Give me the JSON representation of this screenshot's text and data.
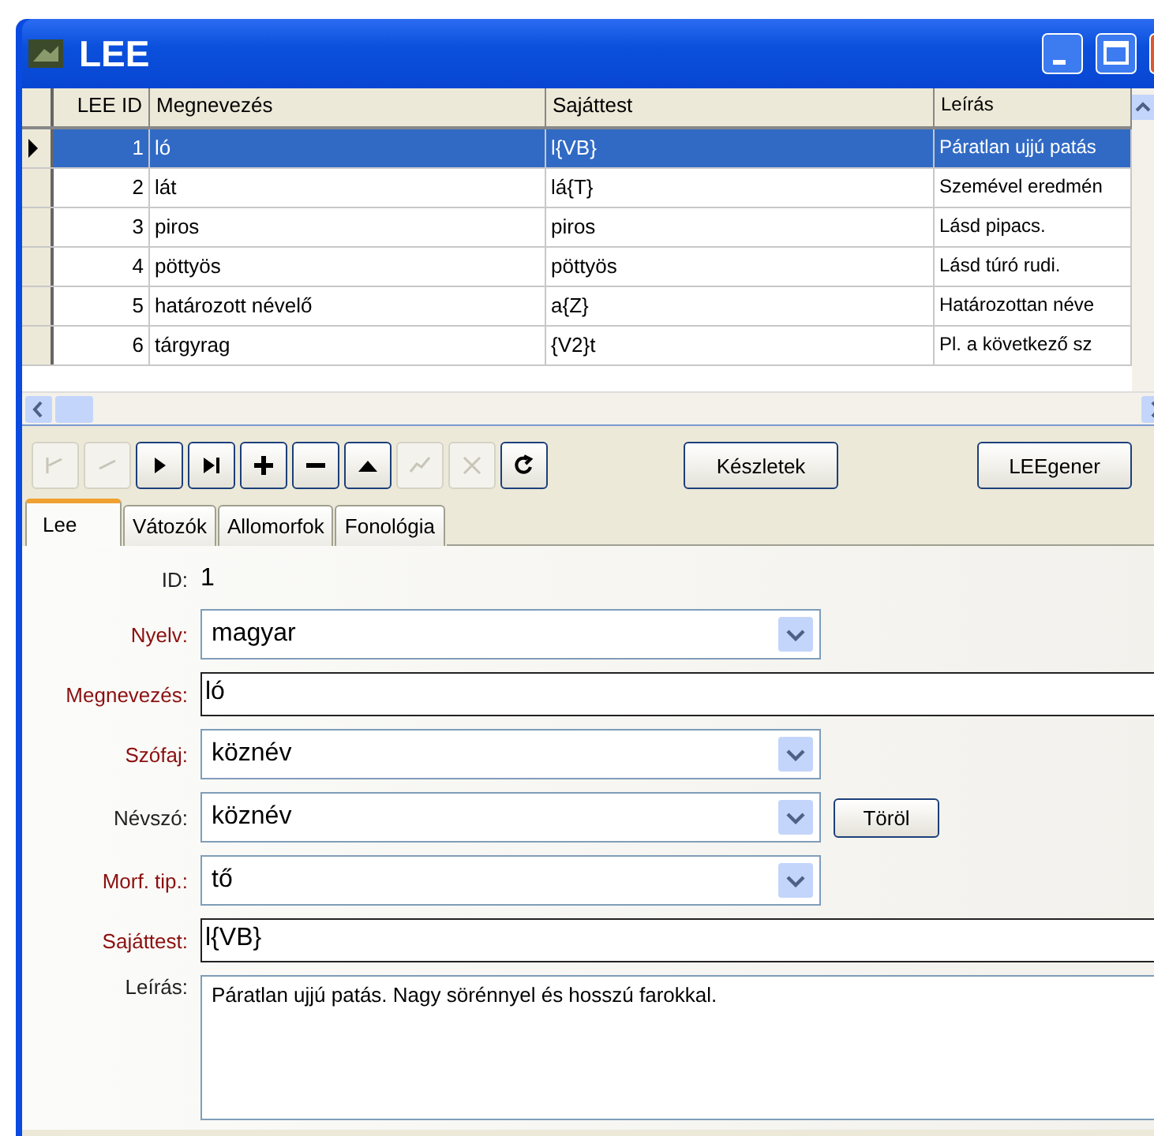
{
  "window": {
    "title": "LEE"
  },
  "table": {
    "columns": [
      "LEE ID",
      "Megnevezés",
      "Sajáttest",
      "Leírás"
    ],
    "rows": [
      {
        "cells": [
          "1",
          "ló",
          "l{VB}",
          "Páratlan ujjú patás"
        ],
        "selected": true
      },
      {
        "cells": [
          "2",
          "lát",
          "lá{T}",
          "Szemével eredmén"
        ],
        "selected": false
      },
      {
        "cells": [
          "3",
          "piros",
          "piros",
          "Lásd pipacs."
        ],
        "selected": false
      },
      {
        "cells": [
          "4",
          "pöttyös",
          "pöttyös",
          "Lásd túró rudi."
        ],
        "selected": false
      },
      {
        "cells": [
          "5",
          "határozott névelő",
          "a{Z}",
          "Határozottan néve"
        ],
        "selected": false
      },
      {
        "cells": [
          "6",
          "tárgyrag",
          "{V2}t",
          "Pl. a következő sz"
        ],
        "selected": false
      }
    ]
  },
  "toolbar": [
    {
      "kind": "first",
      "disabled": true
    },
    {
      "kind": "prev",
      "disabled": true
    },
    {
      "kind": "next",
      "disabled": false
    },
    {
      "kind": "last",
      "disabled": false
    },
    {
      "kind": "add",
      "disabled": false
    },
    {
      "kind": "remove",
      "disabled": false
    },
    {
      "kind": "up",
      "disabled": false
    },
    {
      "kind": "save",
      "disabled": true
    },
    {
      "kind": "cancel",
      "disabled": true
    },
    {
      "kind": "refresh",
      "disabled": false
    }
  ],
  "buttons": [
    "Készletek",
    "LEEgener"
  ],
  "tabs": [
    {
      "label": "Lee",
      "selected": true
    },
    {
      "label": "Vátozók",
      "selected": false
    },
    {
      "label": "Allomorfok",
      "selected": false
    },
    {
      "label": "Fonológia",
      "selected": false
    }
  ],
  "form": [
    {
      "kind": "readonly",
      "label": "ID:",
      "value": "1",
      "required": false
    },
    {
      "kind": "select",
      "label": "Nyelv:",
      "value": "magyar",
      "required": true
    },
    {
      "kind": "text",
      "label": "Megnevezés:",
      "value": "ló",
      "required": true
    },
    {
      "kind": "select",
      "label": "Szófaj:",
      "value": "köznév",
      "required": true
    },
    {
      "kind": "select",
      "label": "Névszó:",
      "value": "köznév",
      "required": false,
      "button": "Töröl"
    },
    {
      "kind": "select",
      "label": "Morf. tip.:",
      "value": "tő",
      "required": true
    },
    {
      "kind": "text",
      "label": "Sajáttest:",
      "value": "l{VB}",
      "required": true
    },
    {
      "kind": "memo",
      "label": "Leírás:",
      "value": "Páratlan ujjú patás. Nagy sörénnyel és hosszú farokkal.",
      "required": false
    }
  ]
}
